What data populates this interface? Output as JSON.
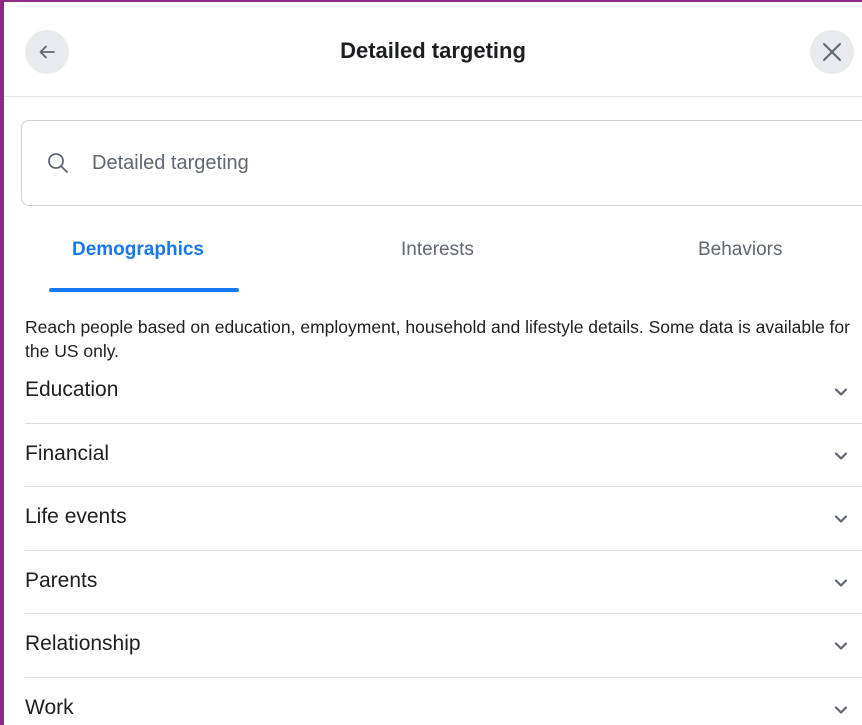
{
  "header": {
    "title": "Detailed targeting",
    "back_icon": "arrow-left-icon",
    "close_icon": "close-icon"
  },
  "search": {
    "placeholder": "Detailed targeting",
    "value": "",
    "icon": "search-icon"
  },
  "tabs": [
    {
      "label": "Demographics",
      "active": true
    },
    {
      "label": "Interests",
      "active": false
    },
    {
      "label": "Behaviors",
      "active": false
    }
  ],
  "description": "Reach people based on education, employment, household and lifestyle details. Some data is available for the US only.",
  "categories": [
    {
      "label": "Education"
    },
    {
      "label": "Financial"
    },
    {
      "label": "Life events"
    },
    {
      "label": "Parents"
    },
    {
      "label": "Relationship"
    },
    {
      "label": "Work"
    }
  ],
  "colors": {
    "accent": "#1877f2",
    "frame": "#8e2a85",
    "text": "#1c1e21",
    "muted": "#606770"
  }
}
